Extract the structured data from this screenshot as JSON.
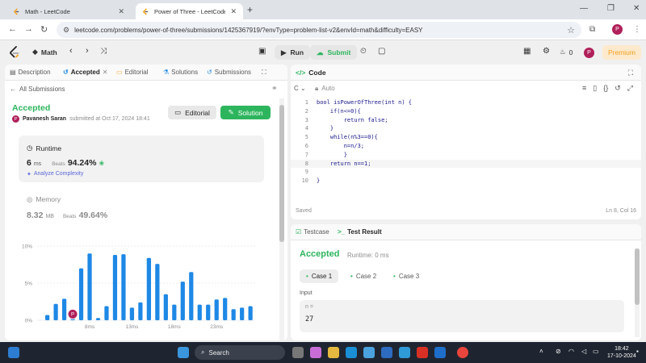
{
  "browser": {
    "tabs": [
      {
        "title": "Math - LeetCode",
        "active": false
      },
      {
        "title": "Power of Three - LeetCode",
        "active": true
      }
    ],
    "url": "leetcode.com/problems/power-of-three/submissions/1425367919/?envType=problem-list-v2&envId=math&difficulty=EASY",
    "profile_initial": "P"
  },
  "lcnav": {
    "list_label": "Math",
    "run_label": "Run",
    "submit_label": "Submit",
    "streak_count": "0",
    "premium_label": "Premium",
    "avatar_initial": "P"
  },
  "left_tabs": [
    {
      "label": "Description"
    },
    {
      "label": "Accepted"
    },
    {
      "label": "Editorial"
    },
    {
      "label": "Solutions"
    },
    {
      "label": "Submissions"
    }
  ],
  "submission": {
    "back_label": "All Submissions",
    "status": "Accepted",
    "user": "Pavanesh Saran",
    "submitted_text": "submitted at Oct 17, 2024 18:41",
    "editorial_btn": "Editorial",
    "solution_btn": "Solution",
    "runtime_label": "Runtime",
    "runtime_value": "6",
    "runtime_unit": "ms",
    "beats_label": "Beats",
    "runtime_beats": "94.24%",
    "analyze_label": "Analyze Complexity",
    "memory_label": "Memory",
    "memory_value": "8.32",
    "memory_unit": "MB",
    "memory_beats": "49.64%"
  },
  "chart_data": {
    "type": "bar",
    "ylabel_ticks": [
      "10%",
      "5%",
      "0%"
    ],
    "ylim": [
      0,
      10
    ],
    "xticks": [
      "8ms",
      "13ms",
      "18ms",
      "23ms"
    ],
    "values": [
      0.7,
      2.2,
      2.9,
      0.5,
      7.0,
      9.0,
      0.3,
      1.9,
      8.8,
      8.9,
      1.7,
      2.4,
      8.4,
      7.6,
      3.5,
      2.1,
      5.2,
      6.5,
      2.1,
      2.1,
      2.8,
      3.0,
      1.5,
      1.7,
      1.9
    ],
    "highlight_index": 3,
    "highlight_label": "P",
    "bar_color": "#1e88e5"
  },
  "code": {
    "title": "Code",
    "language": "C",
    "auto_label": "Auto",
    "lines": [
      "bool isPowerOfThree(int n) {",
      "    if(n<=0){",
      "        return false;",
      "    }",
      "    while(n%3==0){",
      "        n=n/3;",
      "        }",
      "    return n==1;",
      "",
      "}"
    ],
    "current_line": 8,
    "saved_label": "Saved",
    "cursor_pos": "Ln 8, Col 16"
  },
  "test": {
    "testcase_tab": "Testcase",
    "result_tab": "Test Result",
    "status": "Accepted",
    "runtime_text": "Runtime: 0 ms",
    "cases": [
      "Case 1",
      "Case 2",
      "Case 3"
    ],
    "input_label": "Input",
    "param_name": "n =",
    "param_value": "27"
  },
  "taskbar": {
    "search_label": "Search",
    "time": "18:42",
    "date": "17-10-2024"
  }
}
